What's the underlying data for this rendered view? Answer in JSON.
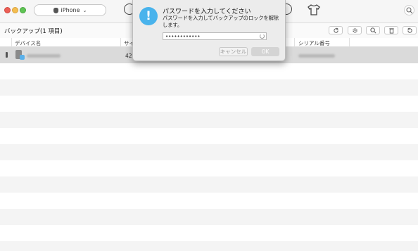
{
  "toolbar": {
    "device_label": "iPhone",
    "icons": [
      "music-icon",
      "download-icon",
      "shirt-icon",
      "search-icon"
    ]
  },
  "backup_bar": {
    "title": "バックアップ(1 項目)",
    "buttons": [
      "refresh-icon",
      "settings-icon",
      "search-icon",
      "delete-icon",
      "restore-icon"
    ]
  },
  "table": {
    "columns": [
      "デバイス名",
      "サイ",
      "シリアル番号"
    ],
    "rows": [
      {
        "size": "42."
      }
    ]
  },
  "dialog": {
    "title": "パスワードを入力してください",
    "message": "パスワードを入力してバックアップのロックを解除します。",
    "password_value": "••••••••••••",
    "cancel_label": "キャンセル",
    "ok_label": "OK"
  },
  "colors": {
    "alert_icon": "#49b3ec",
    "selected_row": "#dadada",
    "alt_row": "#f4f4f4"
  }
}
